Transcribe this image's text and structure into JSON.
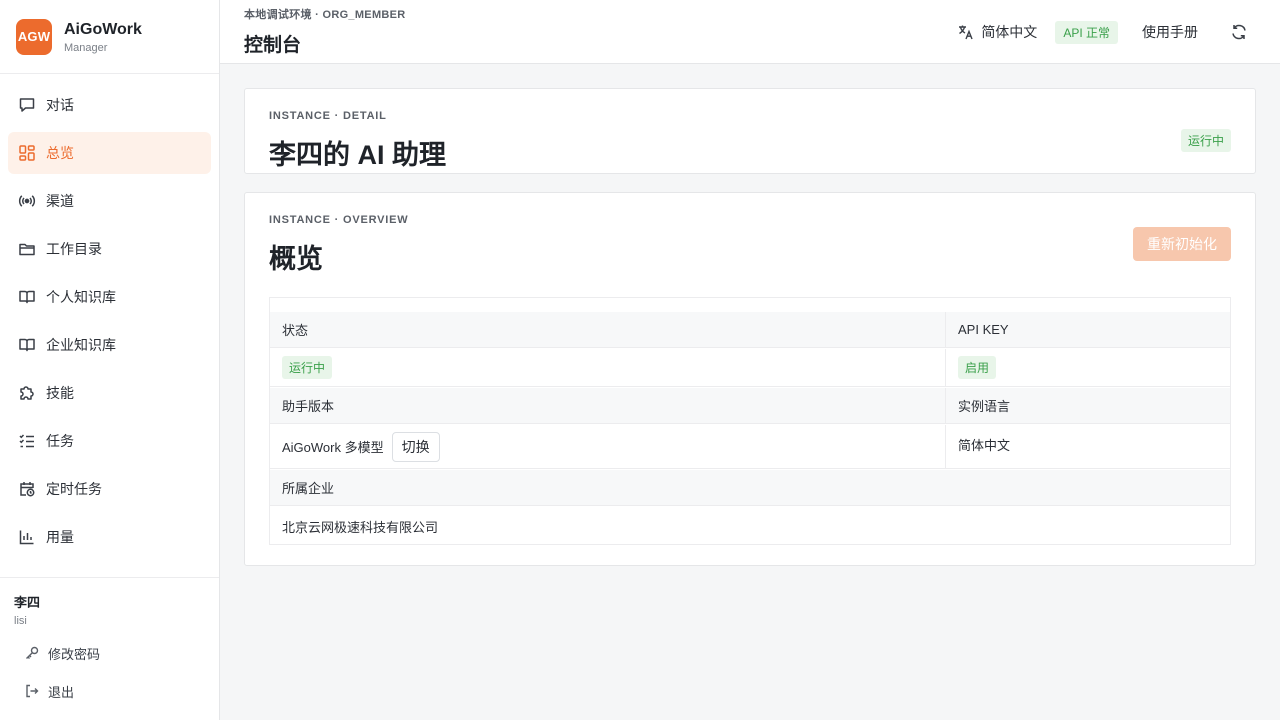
{
  "brand": {
    "logo": "AGW",
    "name": "AiGoWork",
    "role": "Manager",
    "accent": "#ec6b2d"
  },
  "sidebar": {
    "items": [
      {
        "label": "对话",
        "icon": "chat-icon"
      },
      {
        "label": "总览",
        "icon": "dashboard-icon",
        "active": true
      },
      {
        "label": "渠道",
        "icon": "broadcast-icon"
      },
      {
        "label": "工作目录",
        "icon": "folder-icon"
      },
      {
        "label": "个人知识库",
        "icon": "book-icon"
      },
      {
        "label": "企业知识库",
        "icon": "book-icon"
      },
      {
        "label": "技能",
        "icon": "puzzle-icon"
      },
      {
        "label": "任务",
        "icon": "checklist-icon"
      },
      {
        "label": "定时任务",
        "icon": "calendar-clock-icon"
      },
      {
        "label": "用量",
        "icon": "bar-chart-icon"
      }
    ]
  },
  "user": {
    "name": "李四",
    "login": "lisi",
    "change_password": "修改密码",
    "logout": "退出"
  },
  "header": {
    "env": "本地调试环境 · ORG_MEMBER",
    "title": "控制台",
    "language": "简体中文",
    "api_status": "API 正常",
    "manual": "使用手册"
  },
  "detail": {
    "eyebrow": "INSTANCE · DETAIL",
    "title": "李四的 AI 助理",
    "status": "运行中"
  },
  "overview": {
    "eyebrow": "INSTANCE · OVERVIEW",
    "title": "概览",
    "reinit_button": "重新初始化",
    "table": {
      "status_label": "状态",
      "status_value": "运行中",
      "apikey_label": "API KEY",
      "apikey_value": "启用",
      "version_label": "助手版本",
      "version_value": "AiGoWork 多模型",
      "switch_button": "切换",
      "lang_label": "实例语言",
      "lang_value": "简体中文",
      "company_label": "所属企业",
      "company_value": "北京云网极速科技有限公司"
    }
  }
}
